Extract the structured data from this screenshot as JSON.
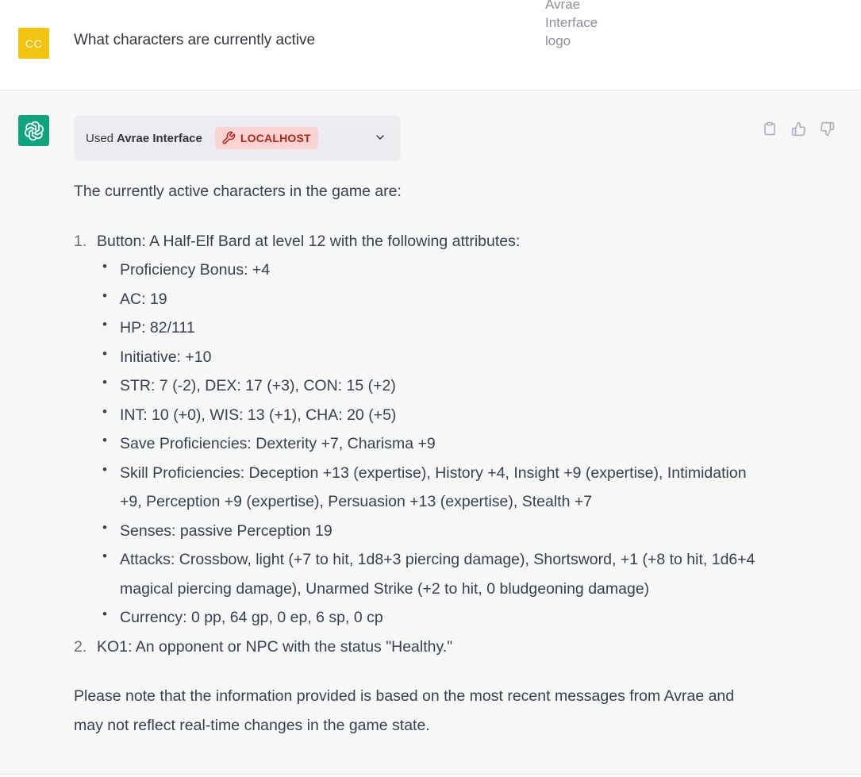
{
  "user": {
    "avatar_initials": "CC",
    "avatar_color": "#f1c40f",
    "message": "What characters are currently active",
    "image_alt": "Avrae Interface logo"
  },
  "assistant": {
    "avatar_icon": "openai-logo-icon",
    "avatar_color": "#10a37f",
    "plugin": {
      "used_label": "Used",
      "name": "Avrae Interface",
      "badge_icon": "wrench-icon",
      "badge": "LOCALHOST"
    },
    "actions": [
      "copy-icon",
      "thumbs-up-icon",
      "thumbs-down-icon"
    ],
    "intro": "The currently active characters in the game are:",
    "characters": [
      {
        "num": "1.",
        "text": "Button: A Half-Elf Bard at level 12 with the following attributes:",
        "attributes": [
          "Proficiency Bonus: +4",
          "AC: 19",
          "HP: 82/111",
          "Initiative: +10",
          "STR: 7 (-2), DEX: 17 (+3), CON: 15 (+2)",
          "INT: 10 (+0), WIS: 13 (+1), CHA: 20 (+5)",
          "Save Proficiencies: Dexterity +7, Charisma +9",
          "Skill Proficiencies: Deception +13 (expertise), History +4, Insight +9 (expertise), Intimidation +9, Perception +9 (expertise), Persuasion +13 (expertise), Stealth +7",
          "Senses: passive Perception 19",
          "Attacks: Crossbow, light (+7 to hit, 1d8+3 piercing damage), Shortsword, +1 (+8 to hit, 1d6+4 magical piercing damage), Unarmed Strike (+2 to hit, 0 bludgeoning damage)",
          "Currency: 0 pp, 64 gp, 0 ep, 6 sp, 0 cp"
        ]
      },
      {
        "num": "2.",
        "text": "KO1: An opponent or NPC with the status \"Healthy.\""
      }
    ],
    "note": "Please note that the information provided is based on the most recent messages from Avrae and may not reflect real-time changes in the game state."
  }
}
